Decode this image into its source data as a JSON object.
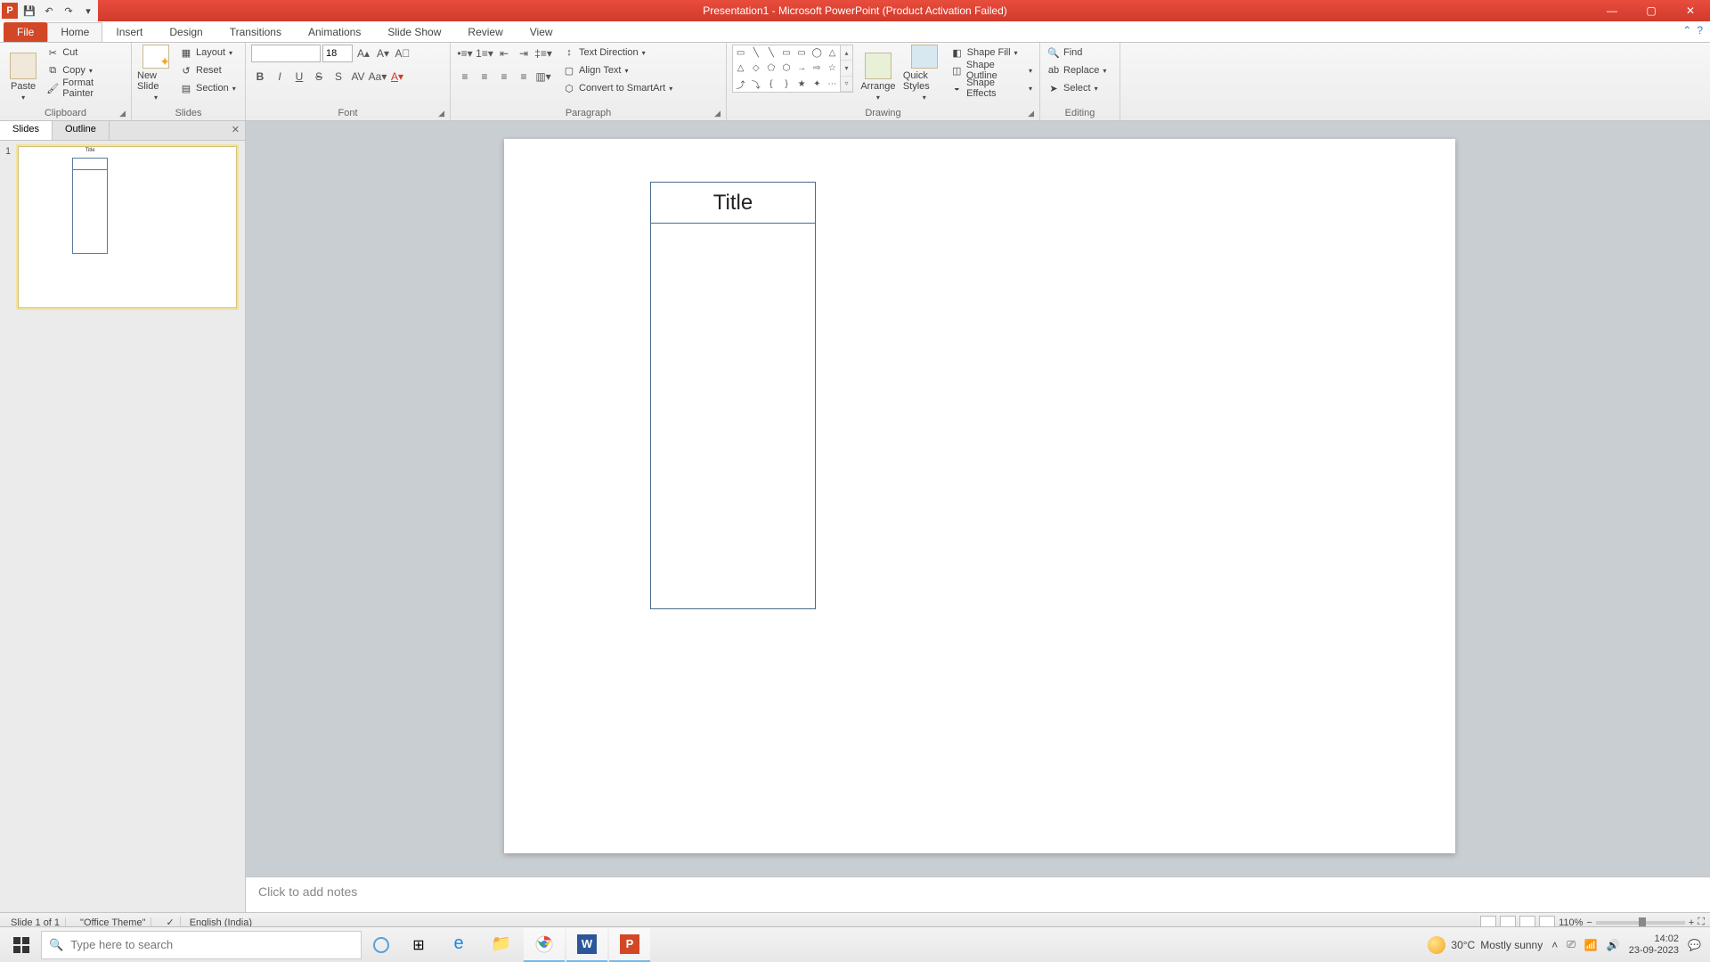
{
  "app": {
    "title": "Presentation1 - Microsoft PowerPoint (Product Activation Failed)"
  },
  "qat": {
    "save": "💾",
    "undo": "↶",
    "redo": "↷",
    "more": "▾"
  },
  "tabs": {
    "file": "File",
    "home": "Home",
    "insert": "Insert",
    "design": "Design",
    "transitions": "Transitions",
    "animations": "Animations",
    "slideshow": "Slide Show",
    "review": "Review",
    "view": "View"
  },
  "ribbon": {
    "clipboard": {
      "label": "Clipboard",
      "paste": "Paste",
      "cut": "Cut",
      "copy": "Copy",
      "format_painter": "Format Painter"
    },
    "slides": {
      "label": "Slides",
      "new_slide": "New Slide",
      "layout": "Layout",
      "reset": "Reset",
      "section": "Section"
    },
    "font": {
      "label": "Font",
      "size": "18"
    },
    "paragraph": {
      "label": "Paragraph",
      "text_direction": "Text Direction",
      "align_text": "Align Text",
      "smartart": "Convert to SmartArt"
    },
    "drawing": {
      "label": "Drawing",
      "arrange": "Arrange",
      "quick_styles": "Quick Styles",
      "shape_fill": "Shape Fill",
      "shape_outline": "Shape Outline",
      "shape_effects": "Shape Effects"
    },
    "editing": {
      "label": "Editing",
      "find": "Find",
      "replace": "Replace",
      "select": "Select"
    }
  },
  "panel": {
    "slides_tab": "Slides",
    "outline_tab": "Outline",
    "thumb_title": "Title",
    "slide_num": "1"
  },
  "slide": {
    "title_cell": "Title"
  },
  "notes": {
    "placeholder": "Click to add notes"
  },
  "status": {
    "slide": "Slide 1 of 1",
    "theme": "\"Office Theme\"",
    "lang": "English (India)",
    "zoom": "110%"
  },
  "taskbar": {
    "search_placeholder": "Type here to search",
    "weather_temp": "30°C",
    "weather_desc": "Mostly sunny",
    "time": "14:02",
    "date": "23-09-2023"
  }
}
